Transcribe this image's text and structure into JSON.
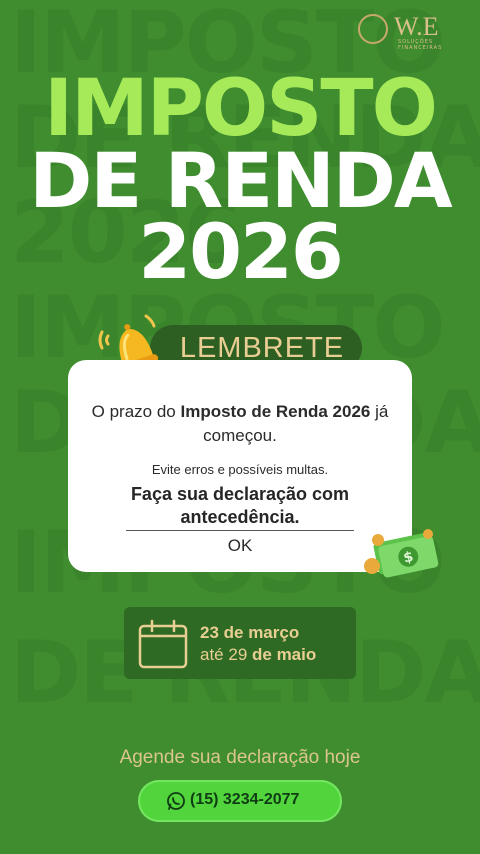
{
  "logo": {
    "text": "W.E",
    "subtext": "SOLUÇÕES FINANCEIRAS"
  },
  "headline": {
    "line1": "IMPOSTO",
    "line2": "DE RENDA",
    "line3": "2026"
  },
  "tag": {
    "label": "LEMBRETE"
  },
  "card": {
    "line1_pre": "O prazo do ",
    "line1_bold": "Imposto de Renda 2026",
    "line1_post": " já começou.",
    "small": "Evite erros e possíveis multas.",
    "bold": "Faça sua declaração com antecedência.",
    "ok": "OK"
  },
  "dates": {
    "start_bold": "23 de março",
    "end_pre": "até ",
    "end_num": "29",
    "end_bold": " de maio"
  },
  "cta": {
    "text": "Agende sua declaração hoje"
  },
  "phone": {
    "number": "(15) 3234-2077"
  },
  "watermark": [
    "IMPOSTO",
    "DE RENDA",
    "2026",
    "IMPOSTO",
    "DE RENDA",
    "IMPOSTO",
    "DE RENDA"
  ],
  "colors": {
    "background": "#3f8d2f",
    "headline_accent": "#a6ea5a",
    "gold": "#e8ce93",
    "button": "#52d43c"
  }
}
